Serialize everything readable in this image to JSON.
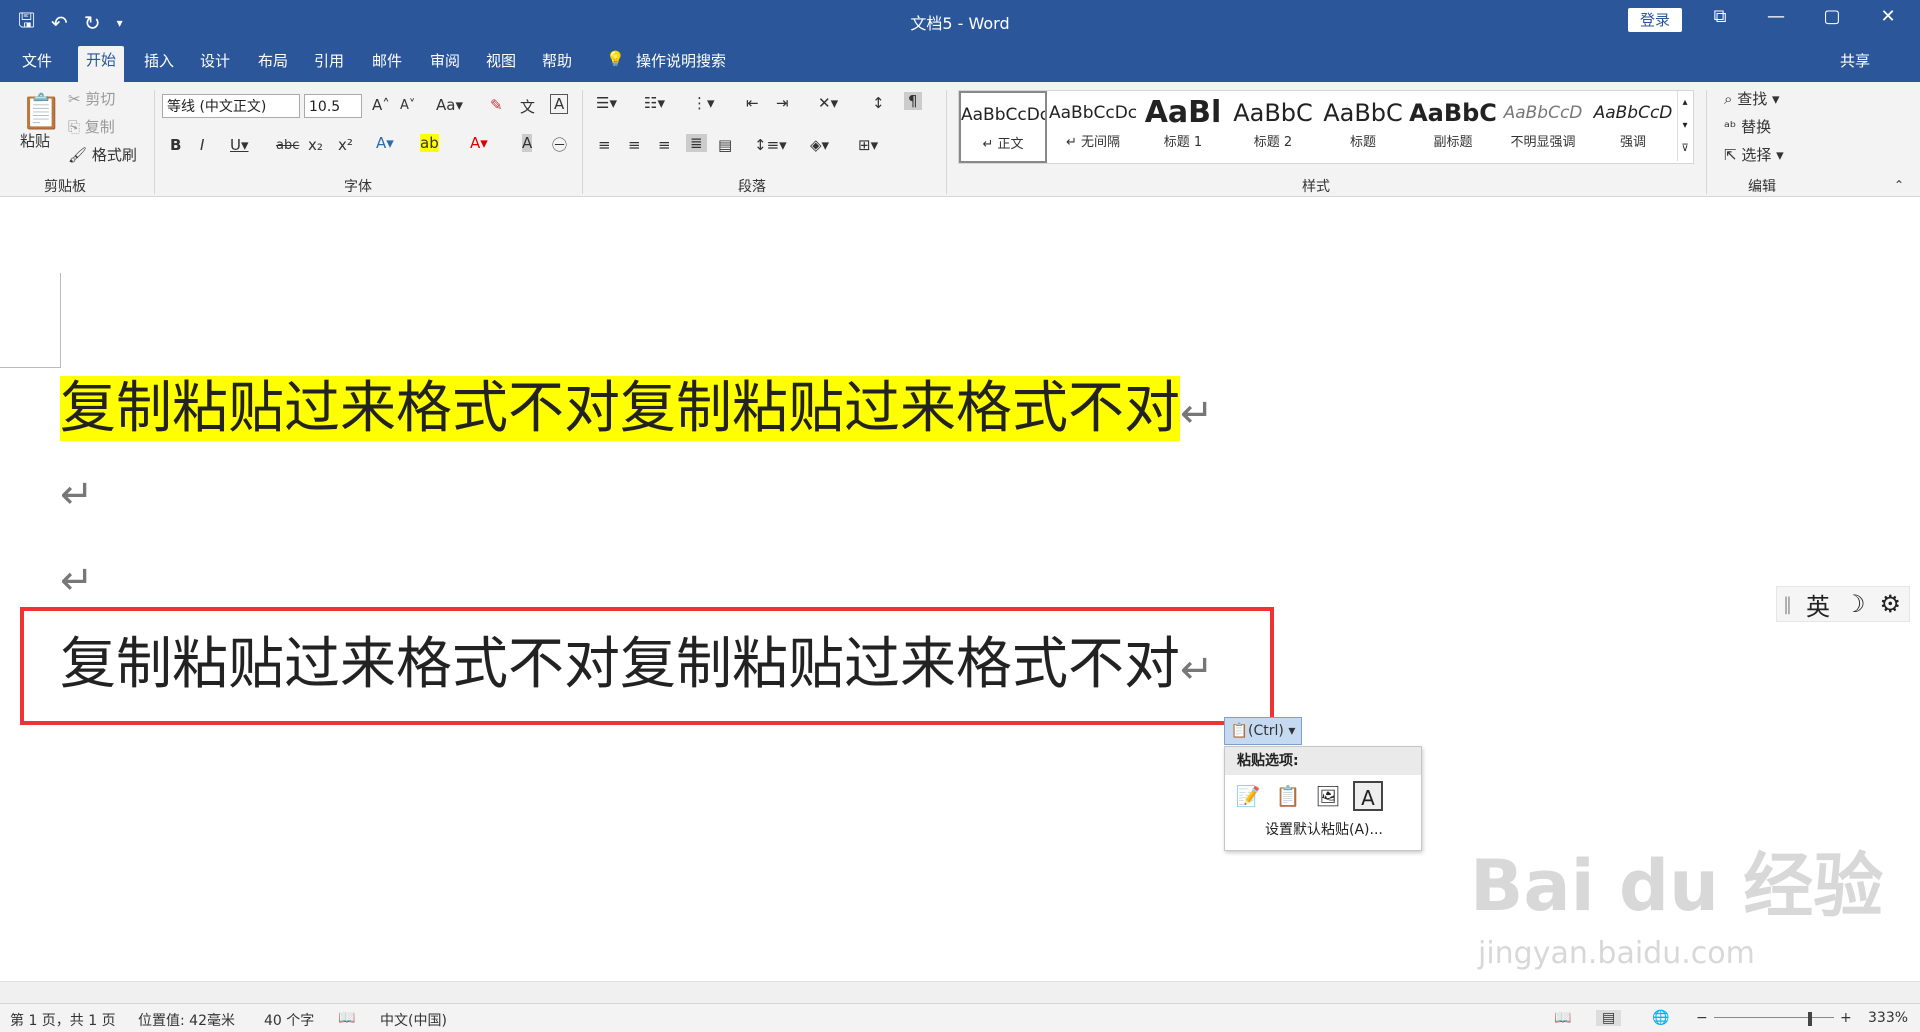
{
  "window": {
    "title": "文档5 - Word",
    "login": "登录",
    "min": "—",
    "max": "▢",
    "close": "✕",
    "restore": "⧉"
  },
  "qat": {
    "save": "🖫",
    "undo": "↶",
    "redo": "↻",
    "more": "▾"
  },
  "tabs": [
    "文件",
    "开始",
    "插入",
    "设计",
    "布局",
    "引用",
    "邮件",
    "审阅",
    "视图",
    "帮助"
  ],
  "tell_me": "操作说明搜索",
  "share": "共享",
  "clipboard": {
    "paste": "粘贴",
    "cut": "剪切",
    "copy": "复制",
    "format_painter": "格式刷",
    "label": "剪贴板"
  },
  "font": {
    "name": "等线 (中文正文)",
    "size": "10.5",
    "label": "字体",
    "buttons": [
      "B",
      "I",
      "U",
      "abc",
      "x₂",
      "x²",
      "A",
      "ab",
      "A",
      "A",
      "㊀"
    ],
    "top": [
      "A",
      "A",
      "Aa",
      "✎",
      "wén",
      "A"
    ]
  },
  "paragraph": {
    "label": "段落"
  },
  "styles": {
    "label": "样式",
    "items": [
      {
        "preview": "AaBbCcDc",
        "name": "↵ 正文"
      },
      {
        "preview": "AaBbCcDc",
        "name": "↵ 无间隔"
      },
      {
        "preview": "AaBl",
        "name": "标题 1"
      },
      {
        "preview": "AaBbC",
        "name": "标题 2"
      },
      {
        "preview": "AaBbC",
        "name": "标题"
      },
      {
        "preview": "AaBbC",
        "name": "副标题"
      },
      {
        "preview": "AaBbCcD",
        "name": "不明显强调"
      },
      {
        "preview": "AaBbCcD",
        "name": "强调"
      }
    ]
  },
  "editing": {
    "find": "查找",
    "replace": "替换",
    "select": "选择",
    "label": "编辑"
  },
  "document": {
    "para1": "复制粘贴过来格式不对复制粘贴过来格式不对",
    "para2": "复制粘贴过来格式不对复制粘贴过来格式不对",
    "mark": "↵"
  },
  "paste_options": {
    "ctrl": "(Ctrl)",
    "header": "粘贴选项:",
    "default": "设置默认粘贴(A)..."
  },
  "ime": {
    "lang": "英",
    "moon": "☽",
    "gear": "⚙",
    "bar": "‖"
  },
  "status": {
    "page": "第 1 页，共 1 页",
    "position": "位置值: 42毫米",
    "words": "40 个字",
    "lang": "中文(中国)",
    "zoom": "333%"
  },
  "watermark": {
    "main": "Bai du 经验",
    "sub": "jingyan.baidu.com"
  }
}
